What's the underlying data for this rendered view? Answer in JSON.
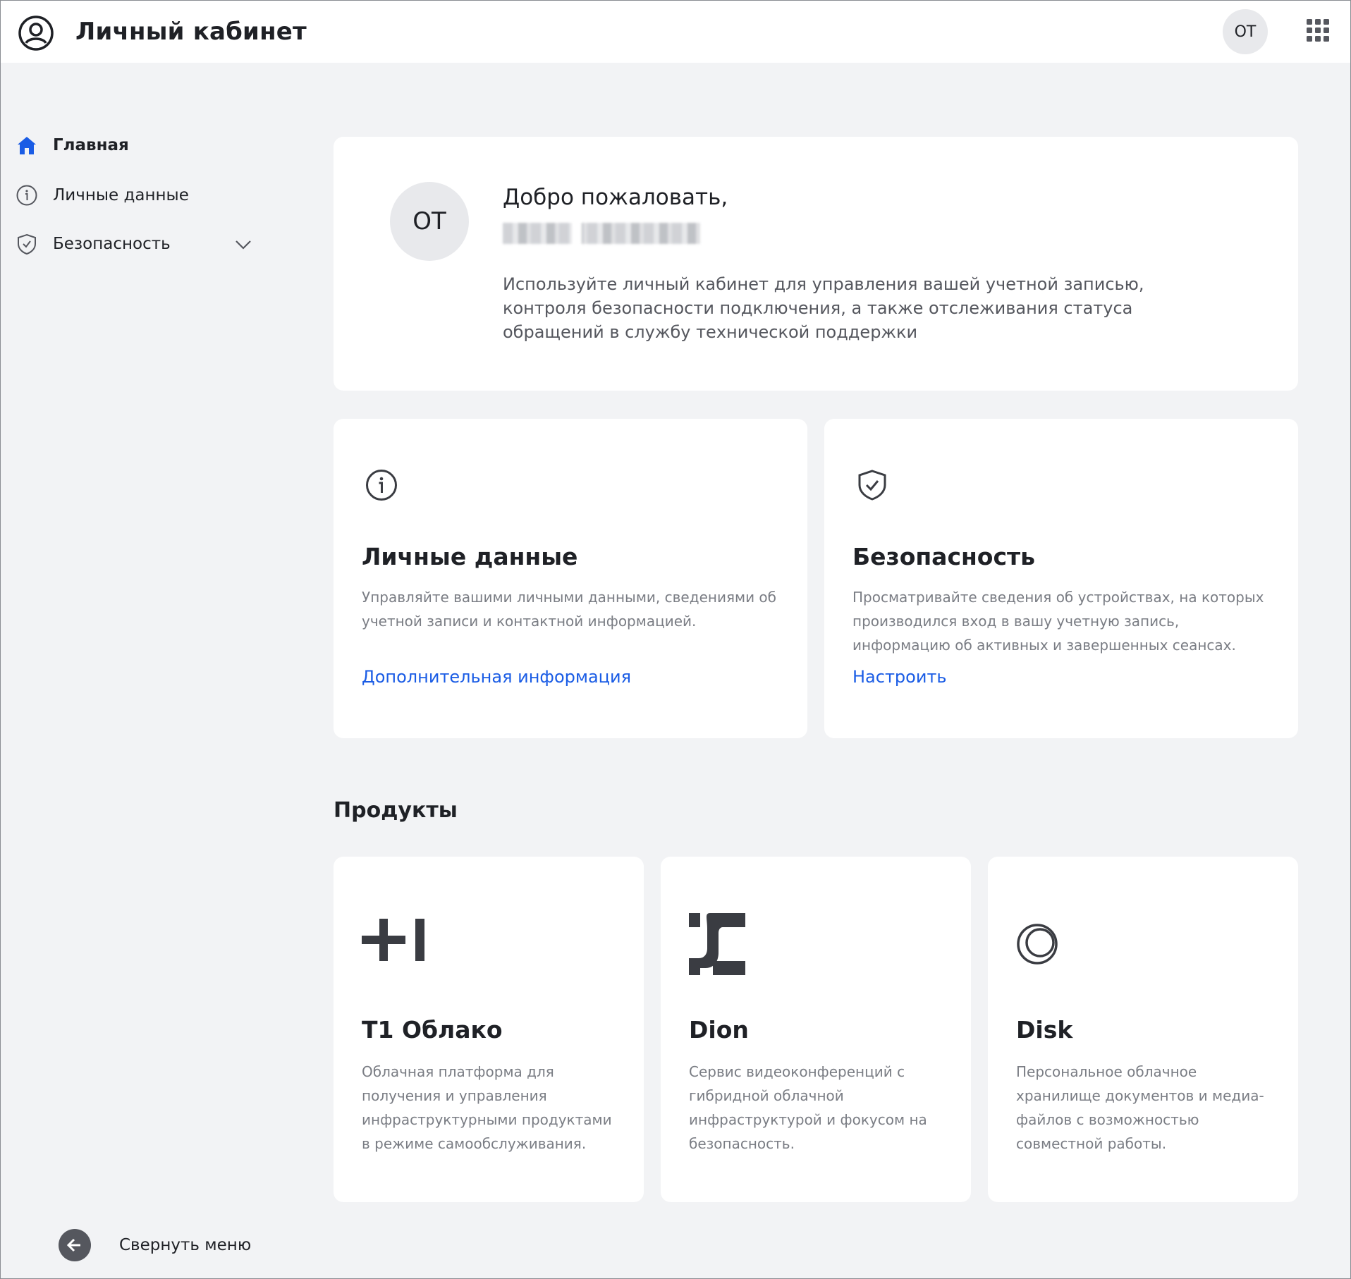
{
  "header": {
    "title": "Личный кабинет",
    "user_initials": "ОТ",
    "logo_icon": "user-circle-icon",
    "apps_icon": "grid-apps-icon"
  },
  "sidebar": {
    "items": [
      {
        "label": "Главная",
        "icon": "home-icon",
        "active": true
      },
      {
        "label": "Личные данные",
        "icon": "info-icon",
        "active": false
      },
      {
        "label": "Безопасность",
        "icon": "shield-check-icon",
        "active": false,
        "expandable": true
      }
    ],
    "collapse_label": "Свернуть меню"
  },
  "welcome": {
    "initials": "ОТ",
    "greeting": "Добро пожаловать,",
    "description": "Используйте личный кабинет для управления вашей учетной записью, контроля безопасности подключения, а также отслеживания статуса обращений в службу технической поддержки"
  },
  "cards": [
    {
      "title": "Личные данные",
      "description": "Управляйте вашими личными данными, сведениями об учетной записи и контактной информацией.",
      "link": "Дополнительная информация",
      "icon": "info-icon"
    },
    {
      "title": "Безопасность",
      "description": "Просматривайте сведения об устройствах, на которых производился вход в вашу учетную запись, информацию об активных и завершенных сеансах.",
      "link": "Настроить",
      "icon": "shield-check-icon"
    }
  ],
  "products": {
    "title": "Продукты",
    "items": [
      {
        "title": "T1 Облако",
        "description": "Облачная платформа для получения и управления инфраструктурными продуктами в режиме самообслуживания."
      },
      {
        "title": "Dion",
        "description": "Сервис видеоконференций с гибридной облачной инфраструктурой и фокусом на безопасность."
      },
      {
        "title": "Disk",
        "description": "Персональное облачное хранилище документов и медиа-файлов с возможностью совместной работы."
      }
    ]
  },
  "colors": {
    "accent": "#1a5ce5",
    "background": "#f2f3f5",
    "card": "#ffffff",
    "text": "#1f2126",
    "muted_text": "#7a7d84"
  }
}
